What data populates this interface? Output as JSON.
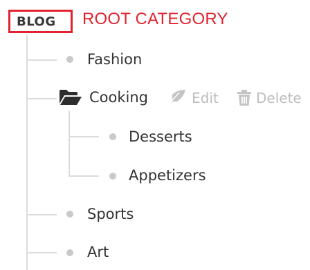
{
  "header": {
    "badge_label": "BLOG",
    "root_label": "ROOT CATEGORY"
  },
  "tree": {
    "items": [
      {
        "label": "Fashion"
      },
      {
        "label": "Cooking",
        "expanded": true,
        "icon": "folder-open-icon",
        "actions": {
          "edit_label": "Edit",
          "edit_icon": "feather-pen-icon",
          "delete_label": "Delete",
          "delete_icon": "trash-icon"
        },
        "children": [
          {
            "label": "Desserts"
          },
          {
            "label": "Appetizers"
          }
        ]
      },
      {
        "label": "Sports"
      },
      {
        "label": "Art"
      }
    ]
  },
  "colors": {
    "accent": "#e0242f",
    "text": "#333333",
    "muted": "#bdbdbd",
    "bullet": "#c9c9c9",
    "line": "#dcdcdc"
  }
}
